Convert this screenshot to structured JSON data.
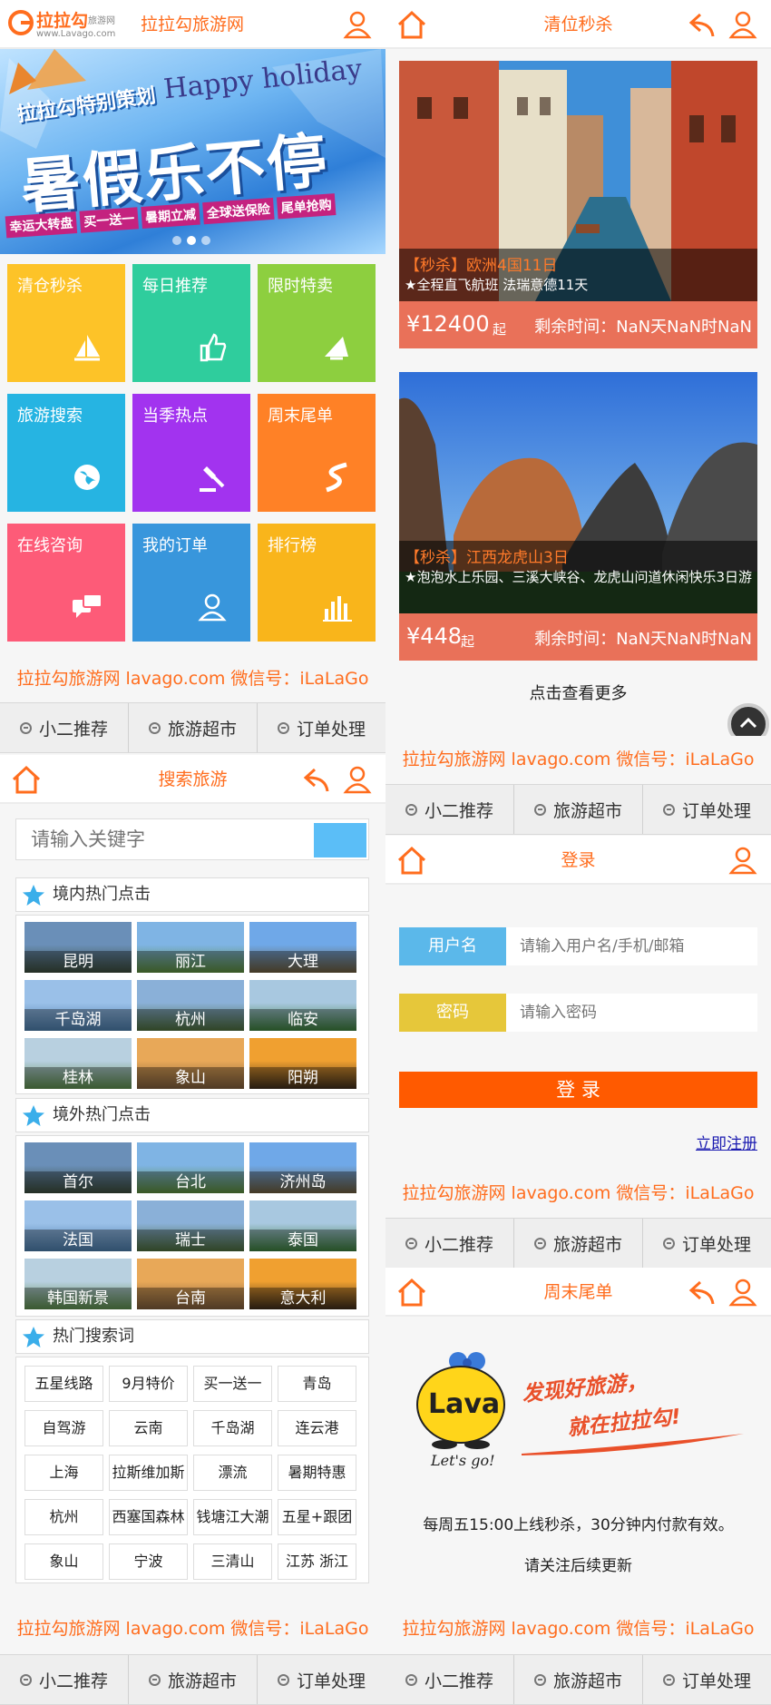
{
  "colors": {
    "accent": "#ff6d1e",
    "tile_yellow": "#fdc328",
    "tile_teal": "#2fcd9d",
    "tile_green": "#8dcf3f",
    "tile_cyan": "#26b4e2",
    "tile_purple": "#a233ef",
    "tile_orange": "#ff8126",
    "tile_pink": "#fd5b78",
    "tile_blue": "#3896dc",
    "tile_gold": "#f9b51b",
    "price_bar": "#e97159",
    "login_button": "#ff5a00",
    "label_blue": "#5bb8ea",
    "label_yellow": "#e6c73a"
  },
  "footer": {
    "text": "拉拉勾旅游网 lavago.com  微信号：iLaLaGo"
  },
  "nav": [
    {
      "label": "小二推荐"
    },
    {
      "label": "旅游超市"
    },
    {
      "label": "订单处理"
    }
  ],
  "home": {
    "logo_text": "拉拉勾",
    "logo_sub": "旅游网",
    "logo_url": "www.Lavago.com",
    "title": "拉拉勾旅游网",
    "banner": {
      "line1": "拉拉勾特别策划",
      "line2": "Happy holiday",
      "headline": "暑假乐不停",
      "tags": [
        "幸运大转盘",
        "买一送一",
        "暑期立减",
        "全球送保险",
        "尾单抢购"
      ]
    },
    "tiles": [
      {
        "label": "清仓秒杀",
        "icon": "sailboat-icon"
      },
      {
        "label": "每日推荐",
        "icon": "thumbs-up-icon"
      },
      {
        "label": "限时特卖",
        "icon": "megaphone-icon"
      },
      {
        "label": "旅游搜索",
        "icon": "globe-icon"
      },
      {
        "label": "当季热点",
        "icon": "gavel-icon"
      },
      {
        "label": "周末尾单",
        "icon": "road-icon"
      },
      {
        "label": "在线咨询",
        "icon": "chat-bubbles-icon"
      },
      {
        "label": "我的订单",
        "icon": "user-icon"
      },
      {
        "label": "排行榜",
        "icon": "bar-chart-icon"
      }
    ]
  },
  "search": {
    "title": "搜索旅游",
    "placeholder": "请输入关键字",
    "domestic_title": "境内热门点击",
    "domestic": [
      "昆明",
      "丽江",
      "大理",
      "千岛湖",
      "杭州",
      "临安",
      "桂林",
      "象山",
      "阳朔"
    ],
    "overseas_title": "境外热门点击",
    "overseas": [
      "首尔",
      "台北",
      "济州岛",
      "法国",
      "瑞士",
      "泰国",
      "韩国新景",
      "台南",
      "意大利"
    ],
    "keywords_title": "热门搜索词",
    "keywords": [
      "五星线路",
      "9月特价",
      "买一送一",
      "青岛",
      "自驾游",
      "云南",
      "千岛湖",
      "连云港",
      "上海",
      "拉斯维加斯",
      "漂流",
      "暑期特惠",
      "杭州",
      "西塞国森林",
      "钱塘江大潮",
      "五星+跟团",
      "象山",
      "宁波",
      "三清山",
      "江苏 浙江"
    ]
  },
  "flash": {
    "title": "清位秒杀",
    "items": [
      {
        "tag": "【秒杀】",
        "name": "欧洲4国11日",
        "desc": "★全程直飞航班 法瑞意德11天",
        "price": "¥12400",
        "unit": "起",
        "countdown": "剩余时间：NaN天NaN时NaN"
      },
      {
        "tag": "【秒杀】",
        "name": "江西龙虎山3日",
        "desc": "★泡泡水上乐园、三溪大峡谷、龙虎山问道休闲快乐3日游",
        "price": "¥448",
        "unit": "起",
        "countdown": "剩余时间：NaN天NaN时NaN"
      }
    ],
    "more": "点击查看更多"
  },
  "login": {
    "title": "登录",
    "user_label": "用户名",
    "user_placeholder": "请输入用户名/手机/邮箱",
    "pwd_label": "密码",
    "pwd_placeholder": "请输入密码",
    "button": "登 录",
    "register": "立即注册"
  },
  "weekend": {
    "title": "周末尾单",
    "brand": "Lava",
    "brand_sub": "Let's go!",
    "slogan1": "发现好旅游，",
    "slogan2": "就在拉拉勾!",
    "notice": "每周五15:00上线秒杀，30分钟内付款有效。",
    "follow": "请关注后续更新"
  }
}
